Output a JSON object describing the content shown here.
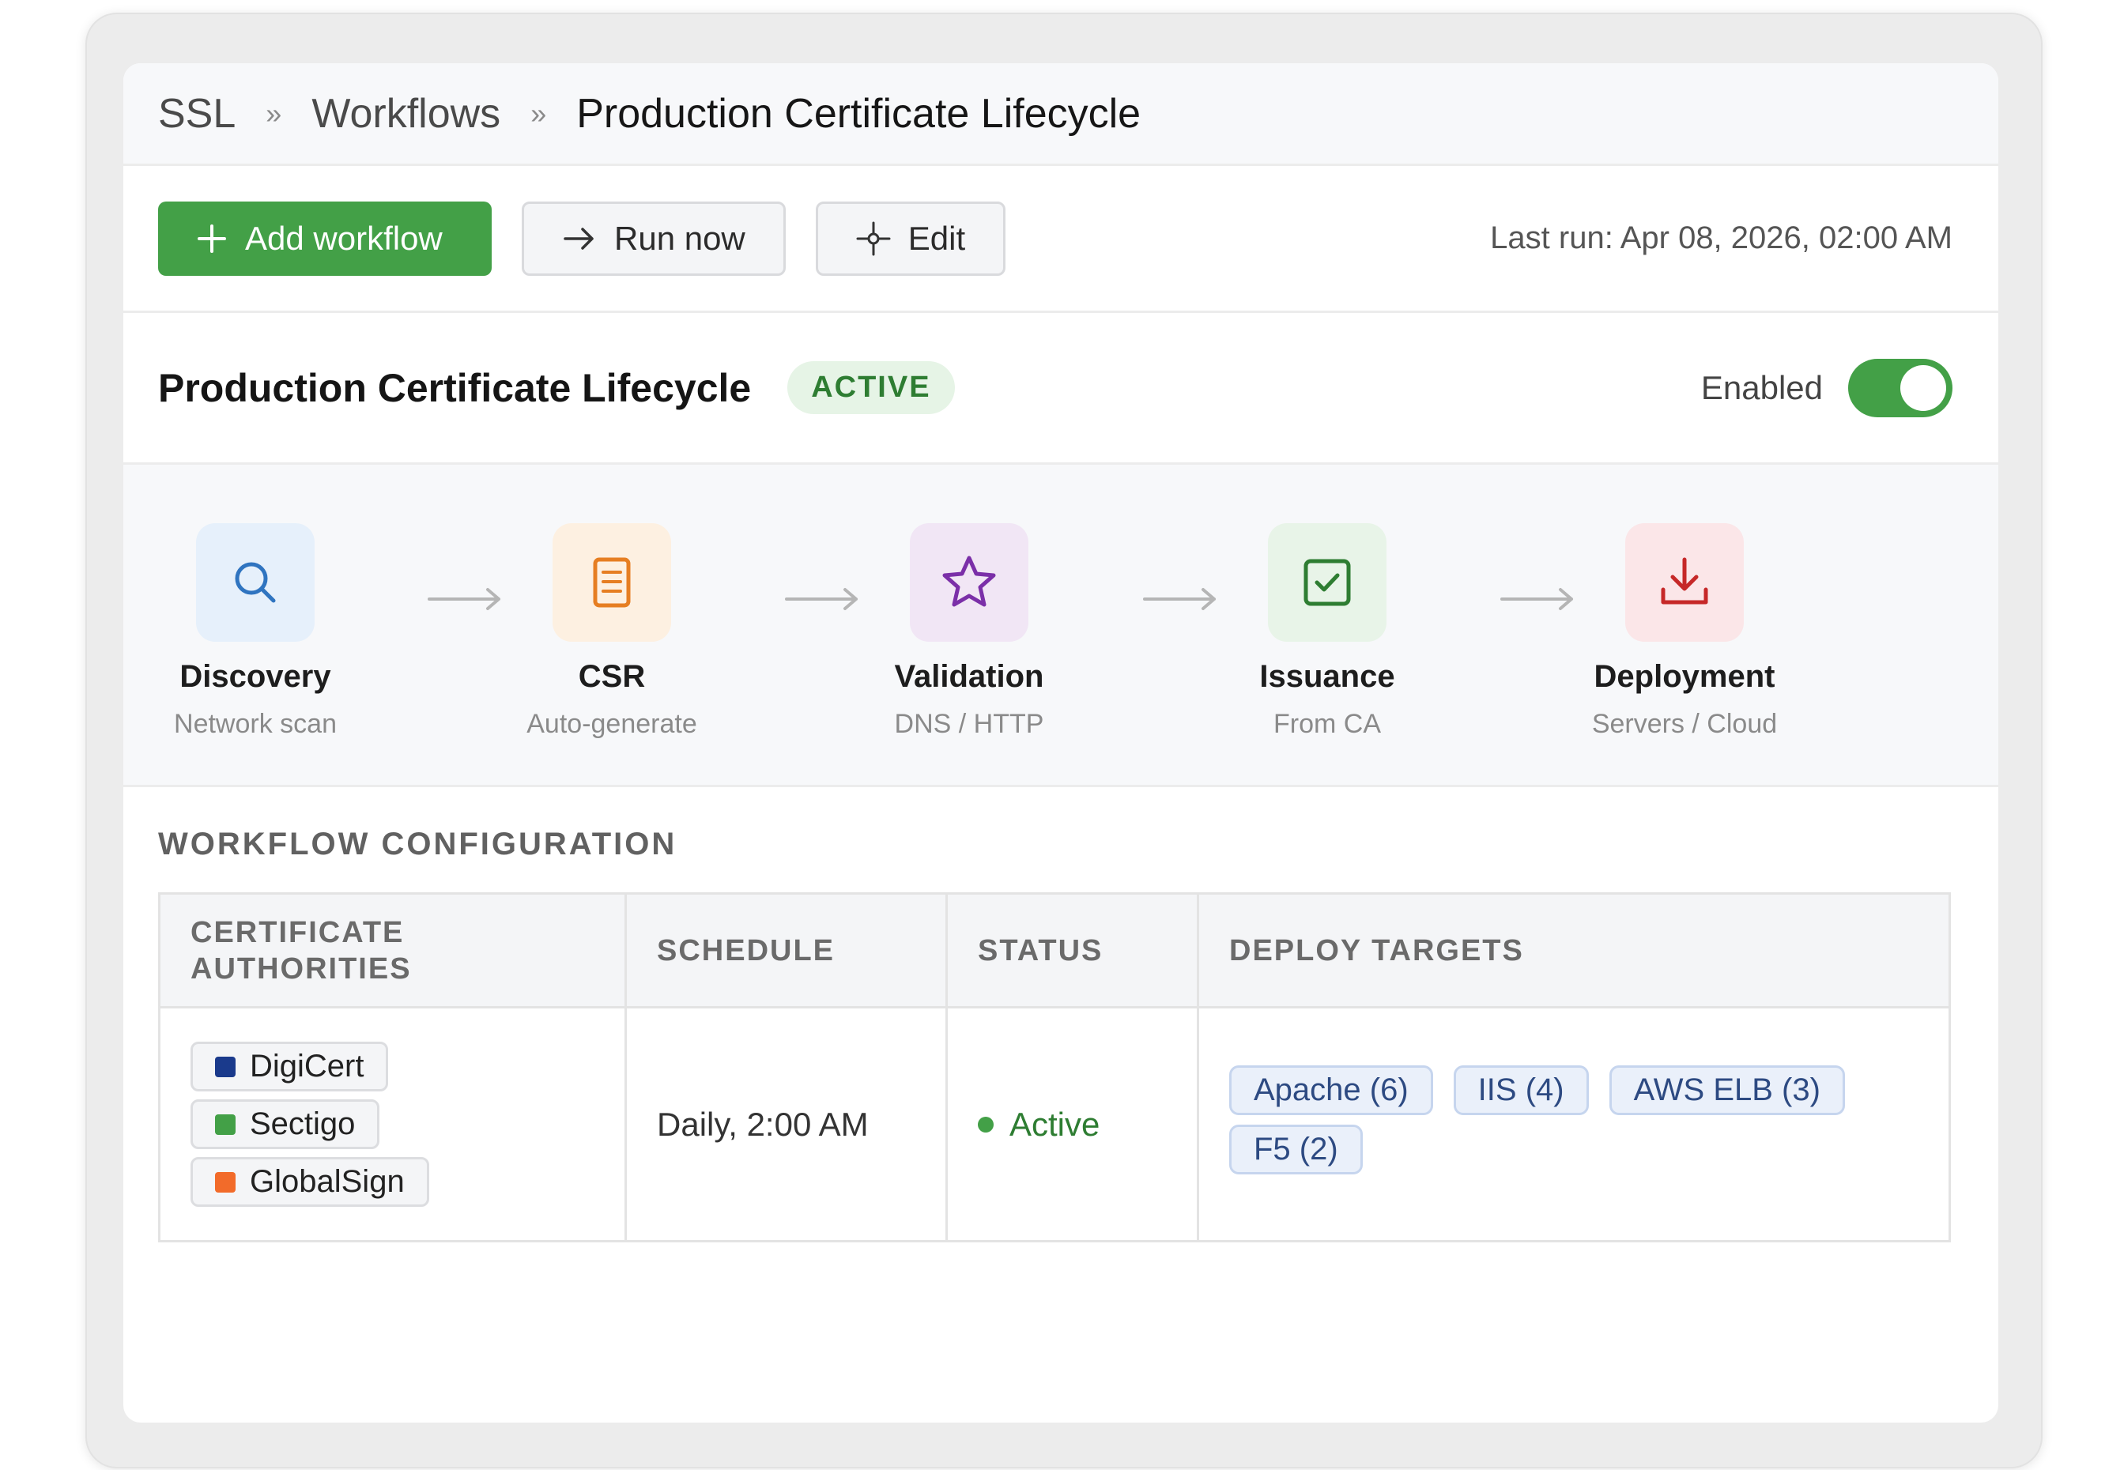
{
  "breadcrumb": {
    "items": [
      "SSL",
      "Workflows"
    ],
    "separator": "»",
    "current": "Production Certificate Lifecycle"
  },
  "toolbar": {
    "add_label": "Add workflow",
    "run_label": "Run now",
    "edit_label": "Edit",
    "last_run": "Last run: Apr 08, 2026, 02:00 AM"
  },
  "workflow": {
    "title": "Production Certificate Lifecycle",
    "badge": "ACTIVE",
    "toggle_label": "Enabled",
    "enabled": true
  },
  "pipeline": {
    "stages": [
      {
        "name": "Discovery",
        "sub": "Network scan",
        "icon": "search-icon",
        "bg": "#e6f0fb",
        "color": "#2f74c0"
      },
      {
        "name": "CSR",
        "sub": "Auto-generate",
        "icon": "document-icon",
        "bg": "#fdf0e1",
        "color": "#e67e22"
      },
      {
        "name": "Validation",
        "sub": "DNS / HTTP",
        "icon": "star-icon",
        "bg": "#f1e6f5",
        "color": "#7b2fa8"
      },
      {
        "name": "Issuance",
        "sub": "From CA",
        "icon": "checkbox-icon",
        "bg": "#e8f4e8",
        "color": "#2e7d32"
      },
      {
        "name": "Deployment",
        "sub": "Servers / Cloud",
        "icon": "download-icon",
        "bg": "#fbe6e8",
        "color": "#c62828"
      }
    ]
  },
  "config": {
    "title": "WORKFLOW CONFIGURATION",
    "headers": [
      "CERTIFICATE AUTHORITIES",
      "SCHEDULE",
      "STATUS",
      "DEPLOY TARGETS"
    ],
    "authorities": [
      {
        "name": "DigiCert",
        "color": "#1a3a8c"
      },
      {
        "name": "Sectigo",
        "color": "#43a047"
      },
      {
        "name": "GlobalSign",
        "color": "#f26b2a"
      }
    ],
    "schedule": "Daily, 2:00 AM",
    "status": "Active",
    "targets": [
      "Apache (6)",
      "IIS (4)",
      "AWS ELB (3)",
      "F5 (2)"
    ]
  }
}
